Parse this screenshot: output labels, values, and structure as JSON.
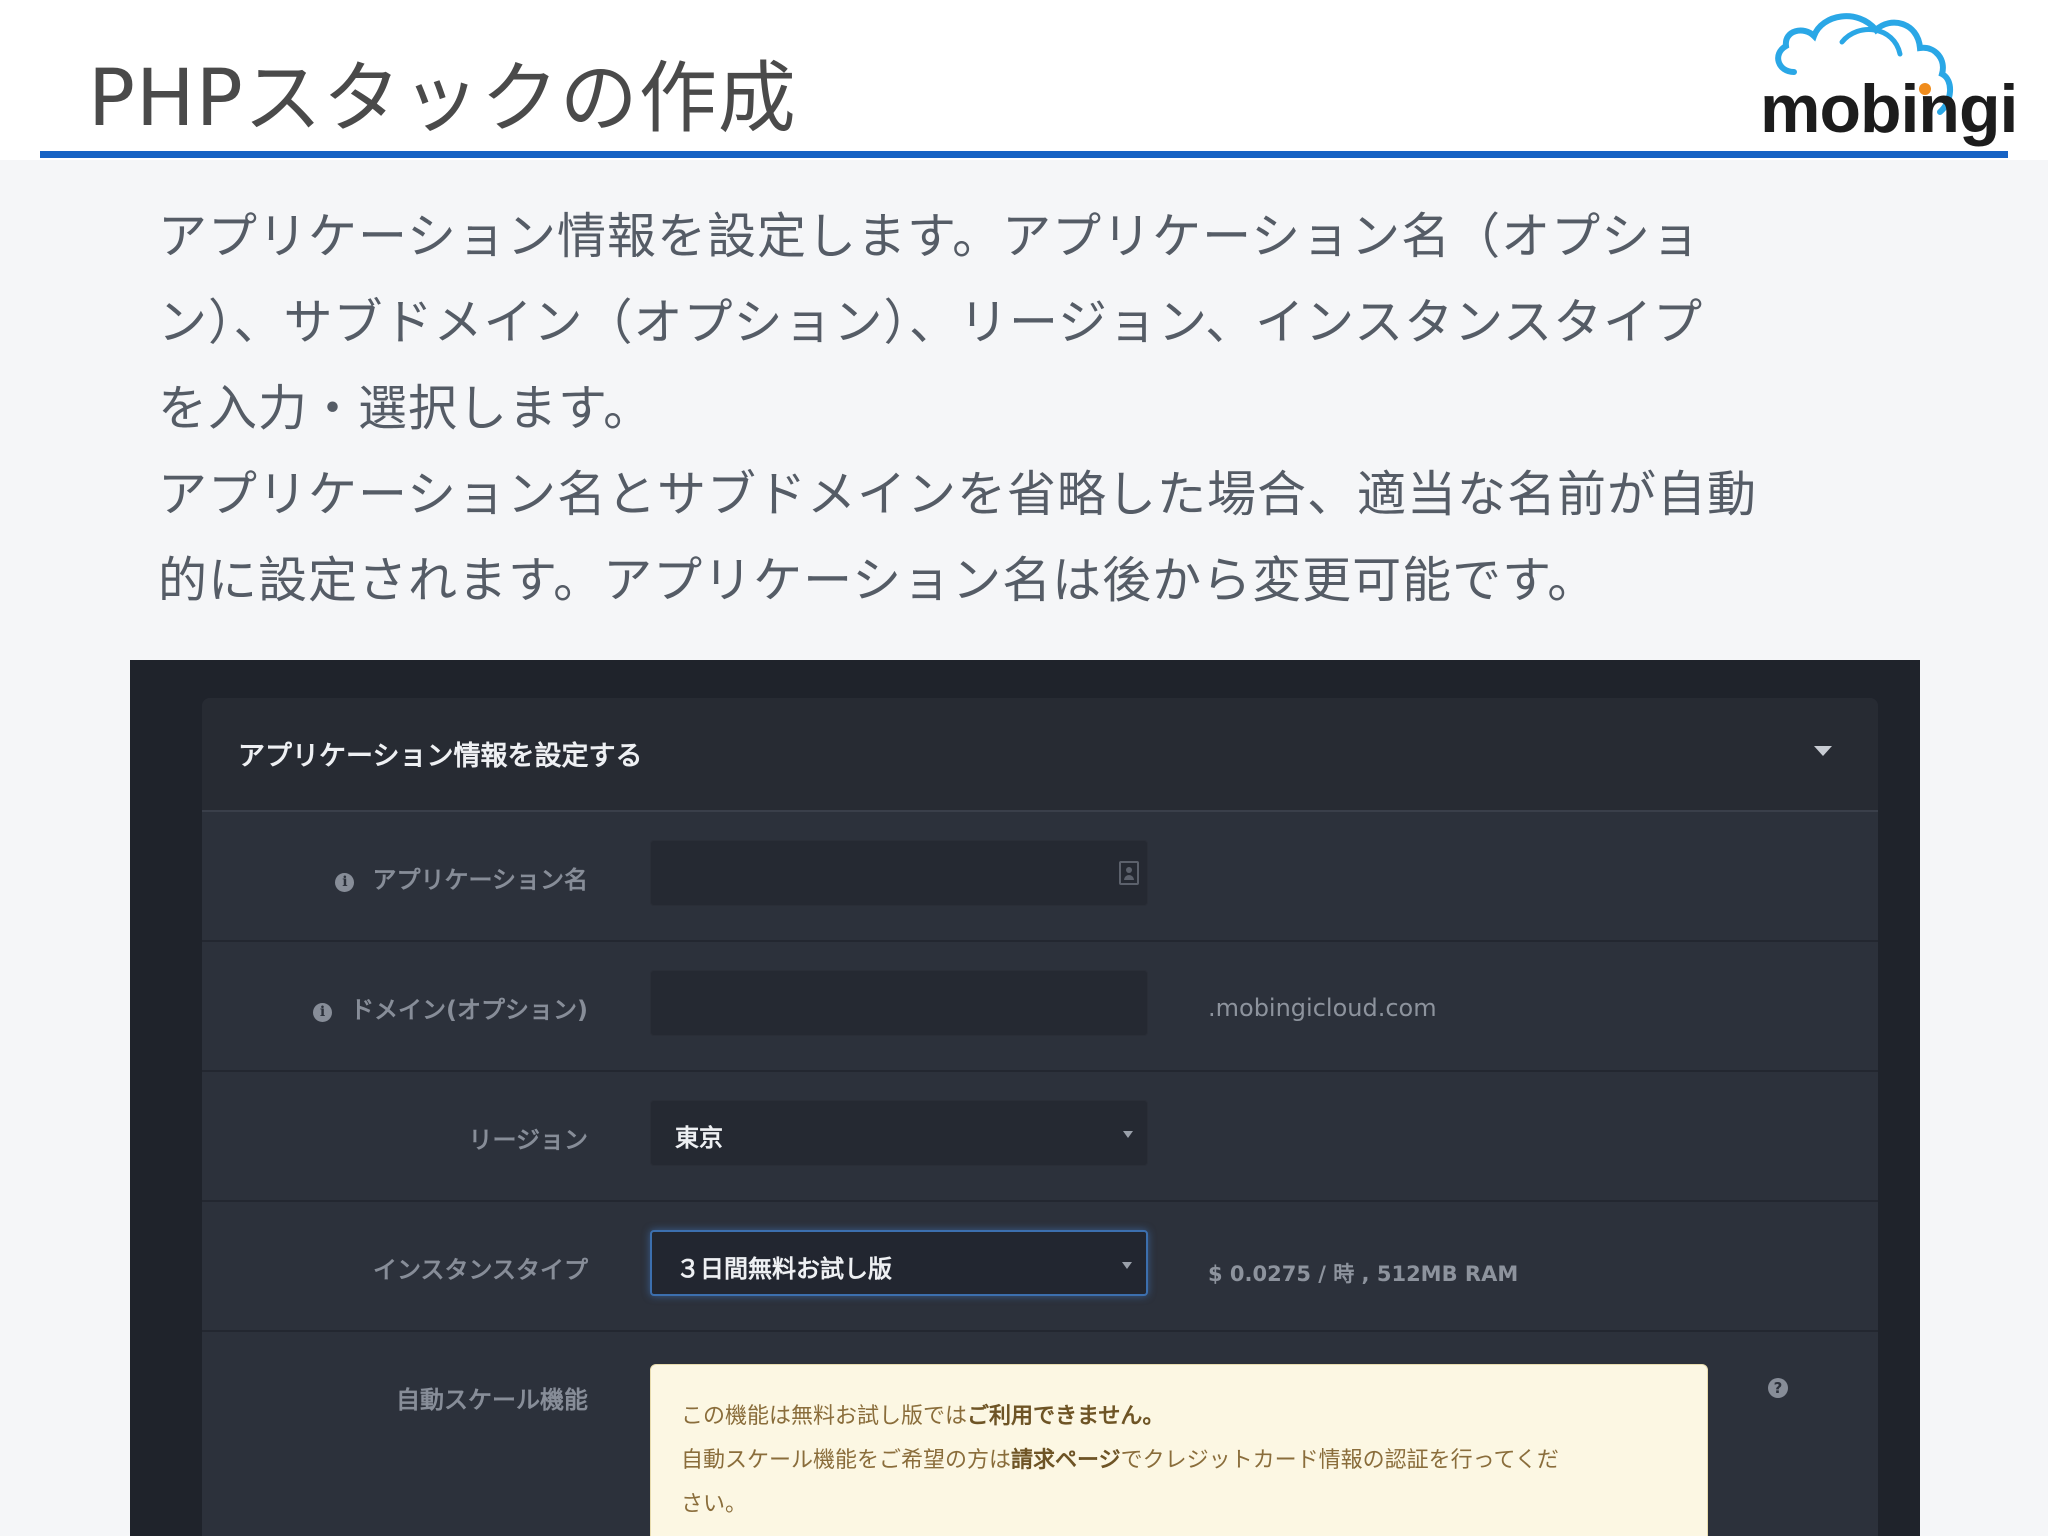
{
  "slide": {
    "title": "PHPスタックの作成",
    "logo_text": "mobingi",
    "accent_color": "#1763c4",
    "description": [
      "アプリケーション情報を設定します。アプリケーション名（オプショ",
      "ン）、サブドメイン（オプション）、リージョン、インスタンスタイプ",
      "を入力・選択します。",
      "アプリケーション名とサブドメインを省略した場合、適当な名前が自動",
      "的に設定されます。アプリケーション名は後から変更可能です。"
    ]
  },
  "app": {
    "card_title": "アプリケーション情報を設定する",
    "collapse_icon": "caret-down-icon",
    "fields": {
      "app_name": {
        "label": "アプリケーション名",
        "value": "",
        "icon": "info-icon"
      },
      "domain": {
        "label": "ドメイン(オプション)",
        "value": "",
        "suffix": ".mobingicloud.com",
        "icon": "info-icon"
      },
      "region": {
        "label": "リージョン",
        "value": "東京"
      },
      "instance_type": {
        "label": "インスタンスタイプ",
        "value": "３日間無料お試し版",
        "price": "$ 0.0275 / 時 , 512MB RAM"
      },
      "autoscale": {
        "label": "自動スケール機能",
        "notice_line1_plain": "この機能は無料お試し版では",
        "notice_line1_bold": "ご利用できません。",
        "notice_line2_plain": "自動スケール機能をご希望の方は",
        "notice_line2_bold": "請求ページ",
        "notice_line2_rest": "でクレジットカード情報の認証を行ってくだ",
        "notice_line3": "さい。",
        "help_icon": "?"
      }
    }
  }
}
